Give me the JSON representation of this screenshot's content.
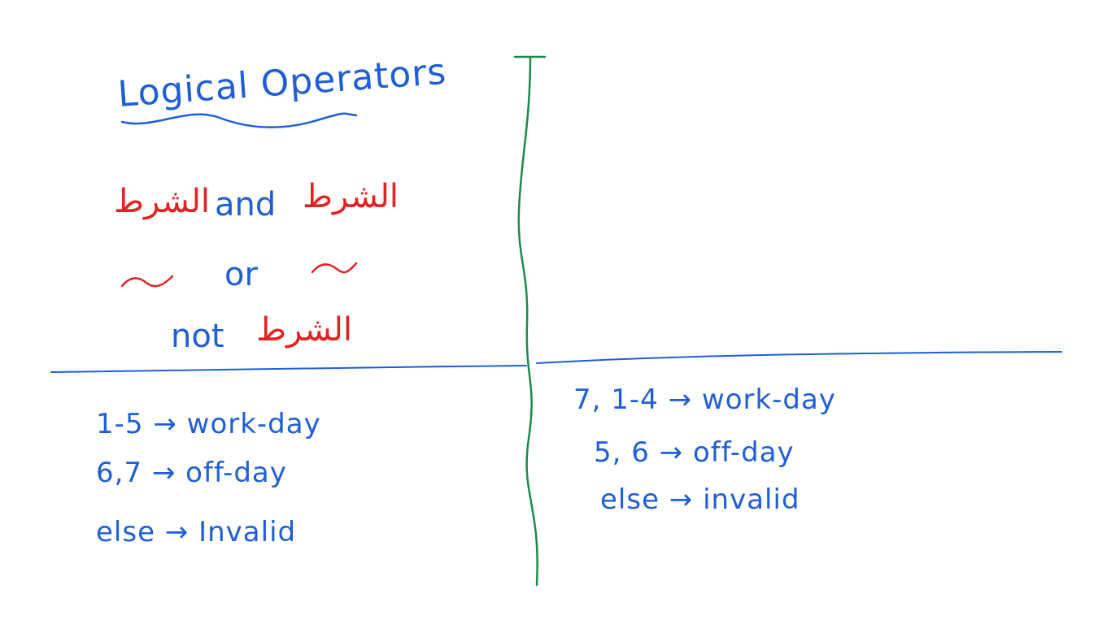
{
  "title": "Logical Operators",
  "operators": {
    "and_left": "الشرط",
    "and_word": "and",
    "and_right": "الشرط",
    "or_left": "~",
    "or_word": "or",
    "or_right": "~",
    "not_word": "not",
    "not_right": "الشرط"
  },
  "left_rules": [
    "1-5 → work-day",
    "6,7 → off-day",
    "else → Invalid"
  ],
  "right_rules": [
    "7, 1-4 → work-day",
    "5, 6 → off-day",
    "else → invalid"
  ],
  "colors": {
    "ink_blue": "#1f5ed6",
    "ink_red": "#e02424",
    "ink_green": "#1a8a4a",
    "background": "#ffffff"
  }
}
